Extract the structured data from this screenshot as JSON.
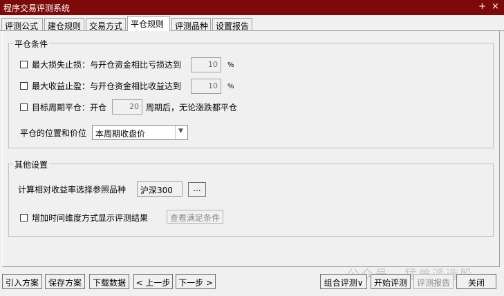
{
  "window": {
    "title": "程序交易评测系统",
    "minimize_icon": "minimize-icon",
    "close_icon": "close-icon",
    "minimize_glyph": "+",
    "close_glyph": "×"
  },
  "tabs": [
    {
      "label": "评测公式"
    },
    {
      "label": "建仓规则"
    },
    {
      "label": "交易方式"
    },
    {
      "label": "平仓规则"
    },
    {
      "label": "评测品种"
    },
    {
      "label": "设置报告"
    }
  ],
  "active_tab": "平仓规则",
  "close_conditions": {
    "title": "平仓条件",
    "max_loss": {
      "label": "最大损失止损：与开仓资金相比亏损达到",
      "value": "10",
      "unit": "%",
      "checked": false
    },
    "max_profit": {
      "label": "最大收益止盈：与开仓资金相比收益达到",
      "value": "10",
      "unit": "%",
      "checked": false
    },
    "target_period": {
      "label_prefix": "目标周期平仓：开仓",
      "value": "20",
      "label_suffix": "周期后，无论涨跌都平仓",
      "checked": false
    },
    "position_price": {
      "label": "平仓的位置和价位",
      "selected": "本周期收盘价"
    }
  },
  "other_settings": {
    "title": "其他设置",
    "reference": {
      "label": "计算相对收益率选择参照品种",
      "value": "沪深300",
      "browse_label": "..."
    },
    "time_dimension": {
      "label": "增加时间维度方式显示评测结果",
      "checked": false,
      "view_button": "查看满足条件"
    }
  },
  "bottom_buttons": {
    "import": "引入方案",
    "save": "保存方案",
    "download": "下载数据",
    "prev": "< 上一步",
    "next": "下一步 >",
    "combo_eval": "组合评测∨",
    "start_eval": "开始评测",
    "eval_report": "评测报告",
    "close": "关闭"
  },
  "watermark": "公众号 · 猛兽派选股",
  "colors": {
    "titlebar": "#7c0a0a",
    "background": "#f0f0f0"
  }
}
